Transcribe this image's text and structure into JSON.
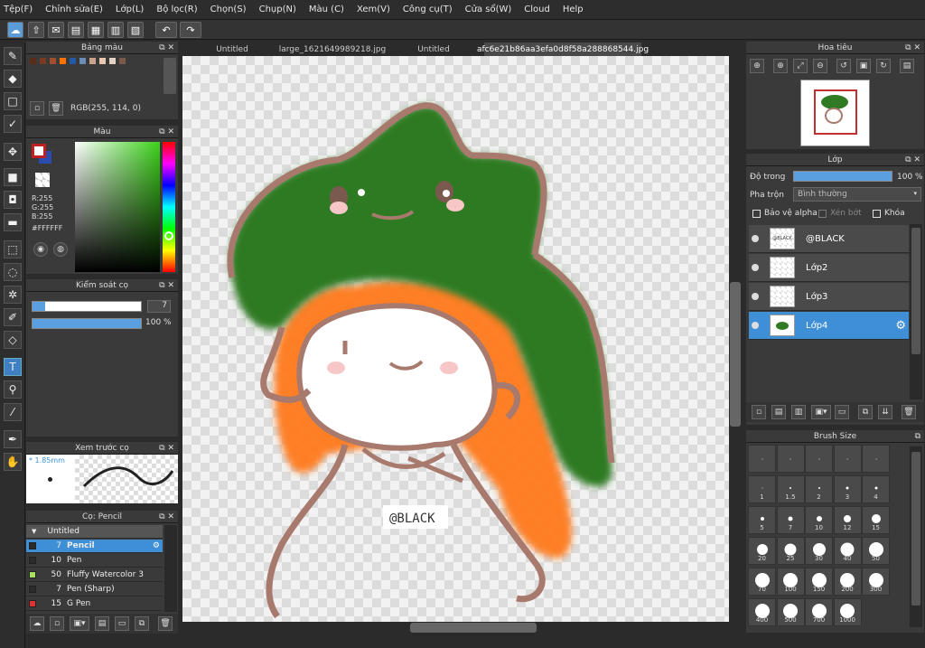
{
  "menu": [
    "Tệp(F)",
    "Chỉnh sửa(E)",
    "Lớp(L)",
    "Bộ lọc(R)",
    "Chọn(S)",
    "Chụp(N)",
    "Màu (C)",
    "Xem(V)",
    "Công cụ(T)",
    "Cửa sổ(W)",
    "Cloud",
    "Help"
  ],
  "tabs": [
    "Untitled",
    "large_1621649989218.jpg",
    "Untitled",
    "afc6e21b86aa3efa0d8f58a288868544.jpg"
  ],
  "palette_panel": {
    "title": "Bảng màu",
    "rgb_text": "RGB(255, 114, 0)",
    "swatches": [
      "#5b2b1a",
      "#7a3a22",
      "#a24d2c",
      "#ff7200",
      "#2458a8",
      "#6a8db8",
      "#c9a38a",
      "#e9c8b0",
      "#e4d3c2",
      "#7b5a4e"
    ]
  },
  "color_panel": {
    "title": "Màu",
    "r": "R:255",
    "g": "G:255",
    "b": "B:255",
    "hex": "#FFFFFF"
  },
  "brush_control": {
    "title": "Kiểm soát cọ",
    "size": "7",
    "opacity": "100 %"
  },
  "brush_preview": {
    "title": "Xem trước cọ",
    "size_label": "* 1.85mm"
  },
  "brush_list": {
    "title": "Cọ: Pencil",
    "group": "Untitled",
    "items": [
      {
        "size": "7",
        "name": "Pencil",
        "color": "#2b2b2b",
        "selected": true
      },
      {
        "size": "10",
        "name": "Pen",
        "color": "#2b2b2b",
        "selected": false
      },
      {
        "size": "50",
        "name": "Fluffy Watercolor 3",
        "color": "#a8e060",
        "selected": false
      },
      {
        "size": "7",
        "name": "Pen (Sharp)",
        "color": "#2b2b2b",
        "selected": false
      },
      {
        "size": "15",
        "name": "G Pen",
        "color": "#e03030",
        "selected": false
      }
    ]
  },
  "navigator": {
    "title": "Hoa tiêu"
  },
  "layers": {
    "title": "Lớp",
    "opacity_label": "Độ trong",
    "opacity_value": "100 %",
    "opacity_level": 1.0,
    "blend_label": "Pha trộn",
    "blend_value": "Bình thường",
    "protect_alpha": "Bảo vệ alpha",
    "clipping": "Xén bớt",
    "lock": "Khóa",
    "items": [
      {
        "name": "@BLACK",
        "thumb": "@BLACK",
        "selected": false
      },
      {
        "name": "Lớp2",
        "thumb": "",
        "selected": false
      },
      {
        "name": "Lớp3",
        "thumb": "",
        "selected": false
      },
      {
        "name": "Lớp4",
        "thumb": "",
        "selected": true
      }
    ]
  },
  "brush_size": {
    "title": "Brush Size",
    "sizes": [
      "",
      "",
      "",
      "",
      "",
      "1",
      "1.5",
      "2",
      "3",
      "4",
      "5",
      "7",
      "10",
      "12",
      "15",
      "20",
      "25",
      "30",
      "40",
      "50",
      "70",
      "100",
      "150",
      "200",
      "300",
      "400",
      "500",
      "700",
      "1000"
    ]
  },
  "canvas": {
    "watermark": "@BLACK"
  },
  "colors": {
    "accent": "#3f8fd6",
    "hat": "#2f7a22",
    "hair": "#ff7a1a",
    "outline": "#a87a6e"
  }
}
